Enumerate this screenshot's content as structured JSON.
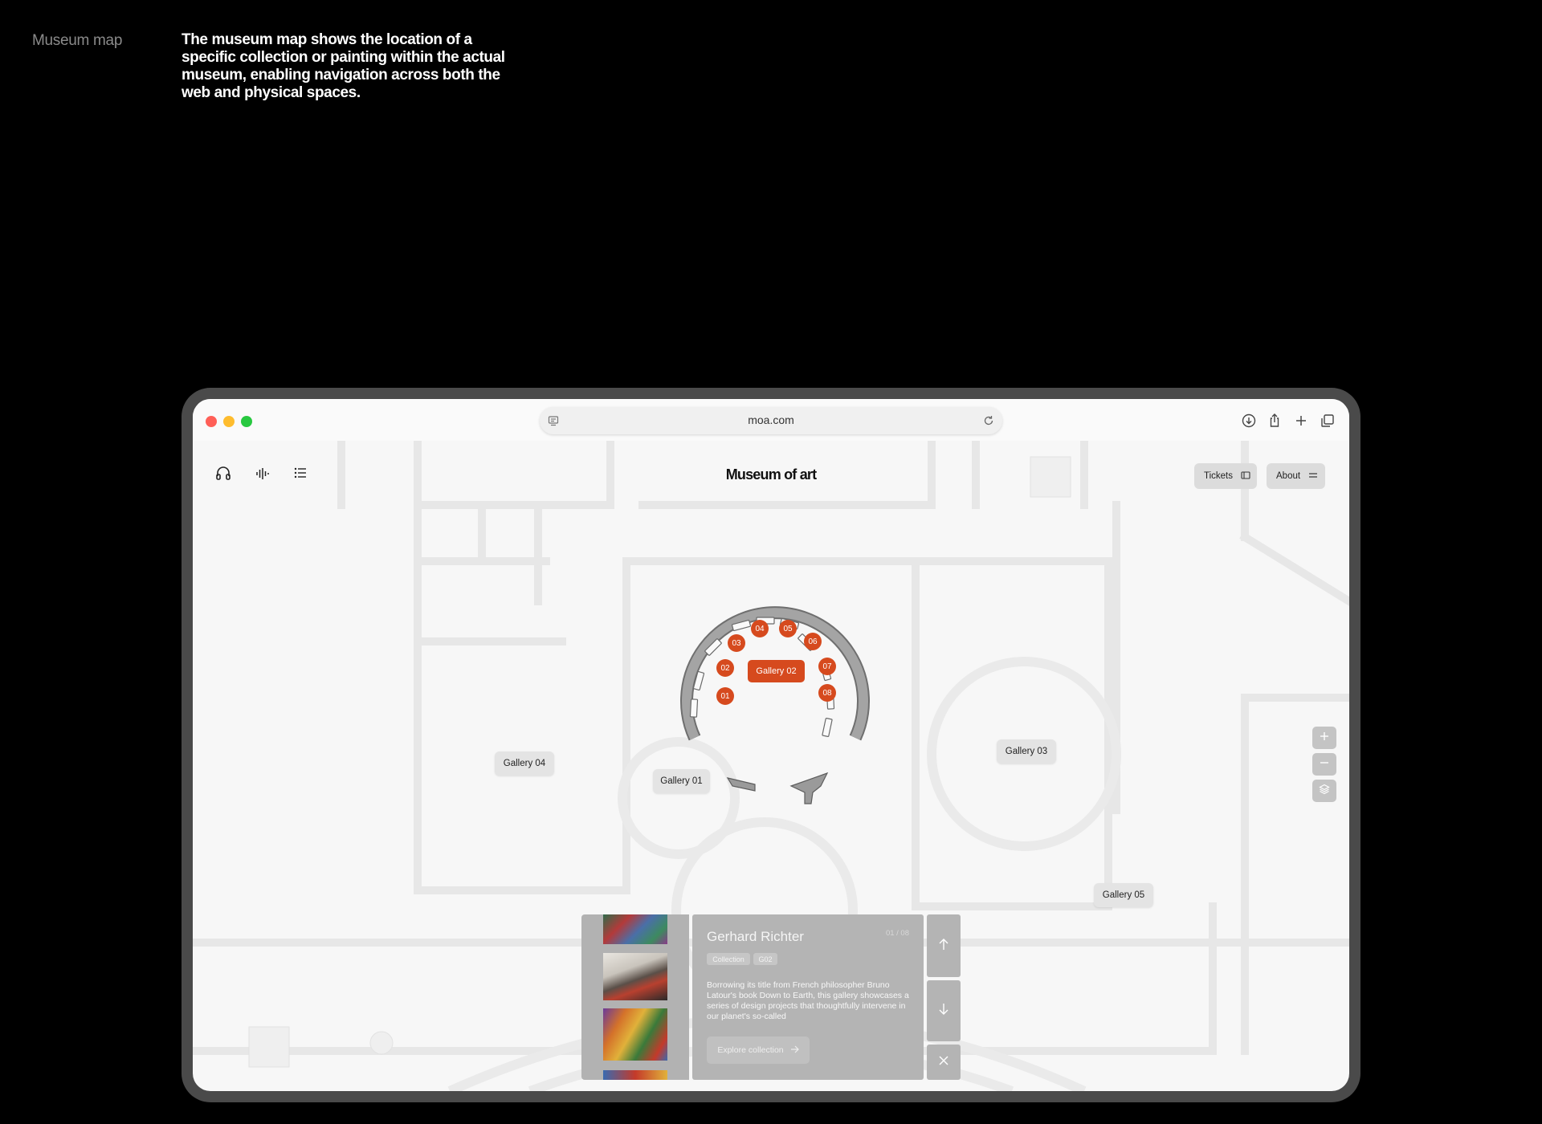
{
  "page": {
    "label": "Museum map",
    "description": "The museum map shows the location of a specific collection or painting within the actual museum, enabling navigation across both the web and physical spaces."
  },
  "browser": {
    "url": "moa.com",
    "traffic_lights": [
      "#ff5f57",
      "#febc2e",
      "#28c840"
    ],
    "toolbar_icons": [
      "download-icon",
      "share-icon",
      "new-tab-icon",
      "tabs-icon"
    ]
  },
  "site": {
    "title": "Museum of art",
    "left_tools": [
      "headphones-icon",
      "audio-wave-icon",
      "list-icon"
    ],
    "tickets_label": "Tickets",
    "about_label": "About"
  },
  "map": {
    "accent_color": "#d64a1e",
    "active_gallery": "Gallery 02",
    "galleries": [
      "Gallery 01",
      "Gallery 03",
      "Gallery 04",
      "Gallery 05"
    ],
    "stops": [
      "01",
      "02",
      "03",
      "04",
      "05",
      "06",
      "07",
      "08"
    ],
    "zoom_controls": [
      "zoom-in-icon",
      "zoom-out-icon",
      "layers-icon"
    ]
  },
  "card": {
    "title": "Gerhard Richter",
    "counter": "01 / 08",
    "tags": [
      "Collection",
      "G02"
    ],
    "description": "Borrowing its title from French philosopher Bruno Latour's book Down to Earth, this gallery showcases a series of design projects that thoughtfully intervene in our planet's so-called",
    "explore_label": "Explore collection"
  }
}
